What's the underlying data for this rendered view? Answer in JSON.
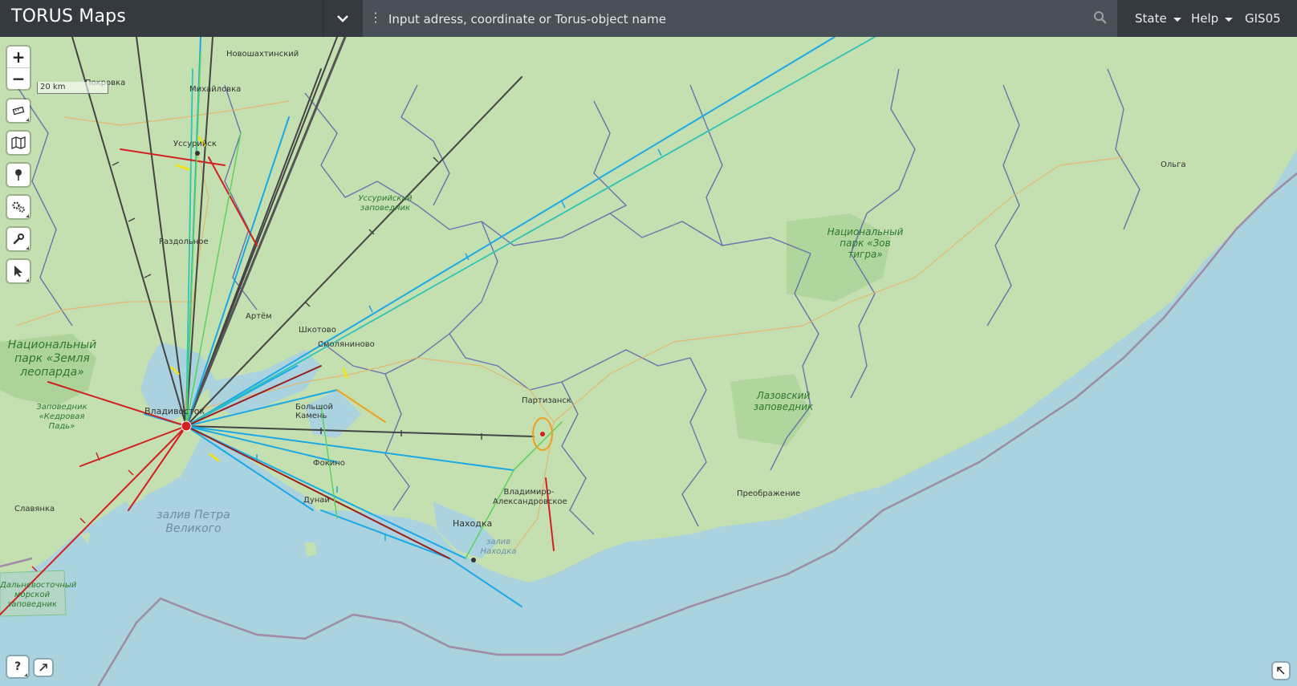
{
  "header": {
    "brand": "TORUS Maps",
    "search_placeholder": "Input adress, coordinate or Torus-object name",
    "menu": [
      {
        "label": "State",
        "has_caret": true
      },
      {
        "label": "Help",
        "has_caret": true
      },
      {
        "label": "GIS05",
        "has_caret": false
      }
    ]
  },
  "map": {
    "scale_label": "20 km",
    "zoom_in": "+",
    "zoom_out": "−",
    "help_label": "?",
    "towns": [
      {
        "name": "Новошахтинский"
      },
      {
        "name": "Покровка"
      },
      {
        "name": "Михайловка"
      },
      {
        "name": "Уссурийск"
      },
      {
        "name": "Раздольное"
      },
      {
        "name": "Артём"
      },
      {
        "name": "Шкотово"
      },
      {
        "name": "Смоляниново"
      },
      {
        "name": "Большой Камень"
      },
      {
        "name": "Владивосток"
      },
      {
        "name": "Фокино"
      },
      {
        "name": "Дунай"
      },
      {
        "name": "Партизанск"
      },
      {
        "name": "Владимиро-Александровское"
      },
      {
        "name": "Находка"
      },
      {
        "name": "Славянка"
      },
      {
        "name": "Преображение"
      },
      {
        "name": "Ольга"
      }
    ],
    "parks": [
      {
        "name": "Национальный парк «Земля леопарда»"
      },
      {
        "name": "Заповедник «Кедровая Падь»"
      },
      {
        "name": "Уссурийский заповедник"
      },
      {
        "name": "Национальный парк «Зов тигра»"
      },
      {
        "name": "Лазовский заповедник"
      },
      {
        "name": "Дальневосточный морской заповедник"
      }
    ],
    "water": [
      {
        "name": "залив Петра Великого"
      },
      {
        "name": "залив Находка"
      }
    ]
  },
  "colors": {
    "land": "#c4dfb0",
    "sea": "#aad3df",
    "admin_border": "#5b5fb0",
    "route_blue": "#1aa9e6",
    "route_teal": "#2ec4b6",
    "route_dark": "#444444",
    "route_red": "#d22020",
    "route_darkred": "#9c1c1c",
    "route_green": "#5ad35a",
    "route_orange": "#f0a020",
    "route_yellow": "#f2e21a",
    "maritime_border": "#a08aa8"
  },
  "icons": {
    "collapse": "chevron-down-icon",
    "search": "search-icon",
    "ruler": "ruler-icon",
    "layers": "map-icon",
    "marker": "pin-icon",
    "settings": "gears-icon",
    "tools": "wrench-icon",
    "select": "cursor-icon",
    "help": "help-icon",
    "expand": "expand-icon",
    "fullscreen": "fullscreen-icon"
  }
}
